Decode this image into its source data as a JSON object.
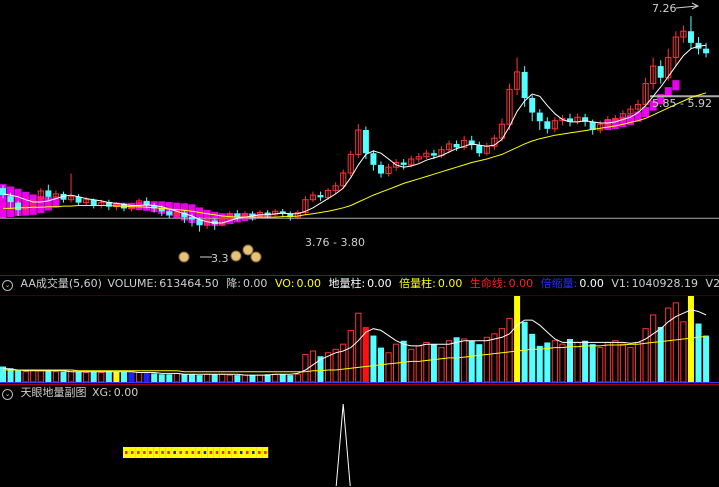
{
  "colors": {
    "bg": "#000000",
    "up": "#ff3232",
    "down": "#54ffff",
    "ma": "#ffffff",
    "ma2": "#ffff00",
    "pink": "#ff00ff",
    "divider": "#a00000",
    "ref_line": "#aaaaaa",
    "vol_line1": "#ffffff",
    "vol_line2": "#ffff00"
  },
  "main_panel": {
    "high_label": "7.26",
    "range_label_top": "5.85 - 5.92",
    "range_label_bottom": "3.76 - 3.80",
    "low_label": "3.3"
  },
  "volume_panel": {
    "toggle_icon": "circle-chevron-icon",
    "title": "AA成交量(5,60)",
    "volume_label": "VOLUME:",
    "volume_value": "613464.50",
    "jiang_label": "降:",
    "jiang_value": "0.00",
    "vo_label": "VO:",
    "vo_value": "0.00",
    "dilz_label": "地量柱:",
    "dilz_value": "0.00",
    "beilz_label": "倍量柱:",
    "beilz_value": "0.00",
    "smx_label": "生命线:",
    "smx_value": "0.00",
    "bsl_label": "倍缩量:",
    "bsl_value": "0.00",
    "v1_label": "V1:",
    "v1_value": "1040928.19",
    "v2_label": "V2:"
  },
  "sub_panel": {
    "toggle_icon": "circle-chevron-icon",
    "title": "天眼地量副图",
    "xg_label": "XG:",
    "xg_value": "0.00"
  },
  "chart_data": [
    {
      "type": "candlestick",
      "title": "",
      "annotations": [
        "7.26",
        "5.85 - 5.92",
        "3.76 - 3.80",
        "3.3"
      ],
      "ylim": [
        3.2,
        7.4
      ],
      "candles": [
        [
          4.3,
          4.18,
          4.35,
          4.12
        ],
        [
          4.16,
          4.06,
          4.22,
          3.95
        ],
        [
          4.05,
          3.92,
          4.08,
          3.82
        ],
        [
          3.93,
          3.98,
          4.02,
          3.85
        ],
        [
          3.98,
          4.1,
          4.12,
          3.92
        ],
        [
          4.12,
          4.25,
          4.3,
          4.08
        ],
        [
          4.26,
          4.15,
          4.36,
          4.1
        ],
        [
          4.15,
          4.2,
          4.26,
          4.1
        ],
        [
          4.2,
          4.1,
          4.24,
          4.05
        ],
        [
          4.1,
          4.15,
          4.55,
          4.05
        ],
        [
          4.15,
          4.05,
          4.2,
          4.0
        ],
        [
          4.05,
          4.1,
          4.15,
          4.0
        ],
        [
          4.1,
          4.0,
          4.12,
          3.95
        ],
        [
          4.0,
          4.05,
          4.1,
          3.95
        ],
        [
          4.06,
          3.98,
          4.1,
          3.92
        ],
        [
          3.98,
          4.02,
          4.06,
          3.92
        ],
        [
          4.02,
          3.95,
          4.05,
          3.9
        ],
        [
          3.95,
          4.0,
          4.05,
          3.9
        ],
        [
          4.0,
          4.08,
          4.12,
          3.95
        ],
        [
          4.08,
          4.0,
          4.14,
          3.95
        ],
        [
          4.0,
          3.95,
          4.04,
          3.88
        ],
        [
          3.95,
          3.9,
          4.0,
          3.82
        ],
        [
          3.9,
          3.84,
          3.94,
          3.78
        ],
        [
          3.84,
          3.88,
          3.92,
          3.76
        ],
        [
          3.88,
          3.8,
          3.92,
          3.7
        ],
        [
          3.8,
          3.76,
          3.86,
          3.64
        ],
        [
          3.76,
          3.66,
          3.8,
          3.55
        ],
        [
          3.66,
          3.74,
          3.8,
          3.6
        ],
        [
          3.74,
          3.68,
          3.78,
          3.58
        ],
        [
          3.68,
          3.78,
          3.84,
          3.64
        ],
        [
          3.78,
          3.86,
          3.9,
          3.72
        ],
        [
          3.86,
          3.8,
          3.92,
          3.74
        ],
        [
          3.8,
          3.86,
          3.9,
          3.76
        ],
        [
          3.86,
          3.82,
          3.9,
          3.74
        ],
        [
          3.82,
          3.88,
          3.92,
          3.78
        ],
        [
          3.88,
          3.84,
          3.92,
          3.78
        ],
        [
          3.84,
          3.9,
          3.94,
          3.8
        ],
        [
          3.9,
          3.86,
          3.94,
          3.8
        ],
        [
          3.86,
          3.8,
          3.9,
          3.74
        ],
        [
          3.8,
          3.88,
          3.92,
          3.76
        ],
        [
          3.88,
          4.1,
          4.16,
          3.84
        ],
        [
          4.1,
          4.18,
          4.24,
          4.06
        ],
        [
          4.18,
          4.14,
          4.24,
          4.08
        ],
        [
          4.14,
          4.26,
          4.3,
          4.1
        ],
        [
          4.26,
          4.34,
          4.4,
          4.2
        ],
        [
          4.34,
          4.56,
          4.62,
          4.3
        ],
        [
          4.56,
          4.88,
          4.94,
          4.5
        ],
        [
          4.88,
          5.3,
          5.4,
          4.82
        ],
        [
          5.3,
          4.9,
          5.36,
          4.8
        ],
        [
          4.9,
          4.7,
          4.95,
          4.6
        ],
        [
          4.7,
          4.55,
          4.76,
          4.48
        ],
        [
          4.55,
          4.66,
          4.72,
          4.5
        ],
        [
          4.66,
          4.74,
          4.8,
          4.6
        ],
        [
          4.74,
          4.7,
          4.8,
          4.62
        ],
        [
          4.7,
          4.8,
          4.86,
          4.66
        ],
        [
          4.8,
          4.84,
          4.9,
          4.74
        ],
        [
          4.84,
          4.9,
          4.96,
          4.8
        ],
        [
          4.9,
          4.86,
          4.96,
          4.8
        ],
        [
          4.86,
          4.96,
          5.02,
          4.82
        ],
        [
          4.96,
          5.06,
          5.12,
          4.9
        ],
        [
          5.06,
          5.0,
          5.12,
          4.94
        ],
        [
          5.0,
          5.12,
          5.2,
          4.96
        ],
        [
          5.12,
          5.04,
          5.2,
          4.96
        ],
        [
          5.04,
          4.9,
          5.1,
          4.84
        ],
        [
          4.9,
          5.02,
          5.08,
          4.86
        ],
        [
          5.02,
          5.16,
          5.22,
          4.96
        ],
        [
          5.16,
          5.4,
          5.5,
          5.1
        ],
        [
          5.4,
          6.0,
          6.1,
          5.3
        ],
        [
          6.0,
          6.3,
          6.55,
          5.9
        ],
        [
          6.3,
          5.85,
          6.4,
          5.7
        ],
        [
          5.85,
          5.6,
          5.9,
          5.45
        ],
        [
          5.6,
          5.45,
          5.66,
          5.3
        ],
        [
          5.45,
          5.32,
          5.52,
          5.24
        ],
        [
          5.32,
          5.46,
          5.52,
          5.26
        ],
        [
          5.46,
          5.5,
          5.56,
          5.38
        ],
        [
          5.5,
          5.44,
          5.58,
          5.36
        ],
        [
          5.44,
          5.52,
          5.58,
          5.4
        ],
        [
          5.52,
          5.44,
          5.58,
          5.36
        ],
        [
          5.44,
          5.3,
          5.48,
          5.22
        ],
        [
          5.3,
          5.4,
          5.46,
          5.24
        ],
        [
          5.4,
          5.48,
          5.54,
          5.34
        ],
        [
          5.48,
          5.5,
          5.56,
          5.42
        ],
        [
          5.5,
          5.58,
          5.64,
          5.44
        ],
        [
          5.58,
          5.66,
          5.72,
          5.52
        ],
        [
          5.66,
          5.74,
          5.82,
          5.6
        ],
        [
          5.74,
          6.1,
          6.2,
          5.7
        ],
        [
          6.1,
          6.4,
          6.55,
          6.0
        ],
        [
          6.4,
          6.2,
          6.5,
          6.1
        ],
        [
          6.2,
          6.55,
          6.7,
          6.15
        ],
        [
          6.55,
          6.9,
          7.0,
          6.4
        ],
        [
          6.9,
          7.0,
          7.1,
          6.8
        ],
        [
          7.0,
          6.8,
          7.26,
          6.7
        ],
        [
          6.8,
          6.7,
          6.9,
          6.6
        ],
        [
          6.7,
          6.62,
          6.8,
          6.55
        ]
      ],
      "ma_short": [
        4.2,
        4.18,
        4.15,
        4.1,
        4.06,
        4.06,
        4.08,
        4.12,
        4.16,
        4.18,
        4.15,
        4.12,
        4.1,
        4.08,
        4.05,
        4.04,
        4.02,
        4.0,
        4.0,
        4.01,
        4.0,
        3.98,
        3.94,
        3.9,
        3.86,
        3.82,
        3.76,
        3.72,
        3.7,
        3.7,
        3.74,
        3.78,
        3.8,
        3.82,
        3.84,
        3.84,
        3.86,
        3.87,
        3.86,
        3.86,
        3.9,
        3.96,
        4.04,
        4.12,
        4.2,
        4.3,
        4.48,
        4.7,
        4.88,
        4.94,
        4.9,
        4.8,
        4.7,
        4.66,
        4.68,
        4.72,
        4.78,
        4.82,
        4.86,
        4.92,
        4.98,
        5.02,
        5.06,
        5.04,
        5.02,
        5.04,
        5.14,
        5.36,
        5.62,
        5.8,
        5.92,
        5.88,
        5.72,
        5.58,
        5.48,
        5.44,
        5.44,
        5.46,
        5.44,
        5.42,
        5.42,
        5.44,
        5.48,
        5.52,
        5.6,
        5.72,
        5.88,
        6.04,
        6.22,
        6.4,
        6.58,
        6.7,
        6.74,
        6.76
      ],
      "ma_long": [
        3.95,
        3.95,
        3.96,
        3.96,
        3.97,
        3.97,
        3.98,
        3.98,
        3.99,
        3.99,
        4.0,
        4.0,
        4.0,
        4.0,
        4.0,
        3.99,
        3.99,
        3.98,
        3.98,
        3.97,
        3.96,
        3.95,
        3.94,
        3.93,
        3.92,
        3.9,
        3.88,
        3.86,
        3.84,
        3.82,
        3.81,
        3.8,
        3.8,
        3.8,
        3.8,
        3.8,
        3.8,
        3.81,
        3.81,
        3.82,
        3.84,
        3.86,
        3.88,
        3.9,
        3.93,
        3.96,
        4.0,
        4.06,
        4.12,
        4.18,
        4.23,
        4.28,
        4.33,
        4.38,
        4.42,
        4.46,
        4.5,
        4.54,
        4.58,
        4.62,
        4.66,
        4.7,
        4.74,
        4.77,
        4.8,
        4.84,
        4.88,
        4.94,
        5.0,
        5.06,
        5.11,
        5.15,
        5.18,
        5.21,
        5.23,
        5.25,
        5.27,
        5.29,
        5.31,
        5.33,
        5.35,
        5.37,
        5.4,
        5.43,
        5.46,
        5.5,
        5.56,
        5.62,
        5.68,
        5.74,
        5.8,
        5.86,
        5.9,
        5.94
      ],
      "reference_lines": [
        3.78,
        5.88
      ]
    },
    {
      "type": "bar",
      "title": "AA成交量(5,60)",
      "ylim": [
        0,
        100
      ],
      "volumes": [
        18,
        16,
        14,
        12,
        14,
        13,
        13,
        12,
        12,
        14,
        12,
        11,
        12,
        11,
        13,
        12,
        12,
        11,
        11,
        12,
        10,
        9,
        9,
        10,
        9,
        9,
        8,
        9,
        9,
        9,
        8,
        8,
        8,
        8,
        8,
        9,
        9,
        9,
        8,
        9,
        32,
        36,
        30,
        34,
        38,
        44,
        60,
        80,
        64,
        54,
        40,
        34,
        44,
        48,
        38,
        42,
        46,
        44,
        40,
        48,
        52,
        50,
        48,
        44,
        52,
        56,
        62,
        74,
        100,
        70,
        56,
        42,
        46,
        48,
        44,
        50,
        46,
        48,
        44,
        40,
        46,
        48,
        44,
        40,
        46,
        62,
        78,
        64,
        86,
        92,
        70,
        100,
        68,
        54
      ],
      "highlights": {
        "yellow": [
          15,
          68,
          91
        ],
        "red": [
          48
        ],
        "blue": [
          17,
          19
        ]
      },
      "line1": [
        16,
        15,
        14,
        13,
        13,
        13,
        13,
        13,
        13,
        12,
        12,
        12,
        12,
        12,
        12,
        12,
        12,
        12,
        11,
        11,
        11,
        10,
        10,
        10,
        9,
        9,
        9,
        9,
        9,
        9,
        9,
        9,
        8,
        8,
        8,
        8,
        9,
        9,
        9,
        10,
        14,
        20,
        26,
        30,
        34,
        36,
        40,
        48,
        58,
        62,
        60,
        54,
        48,
        44,
        42,
        42,
        44,
        44,
        44,
        44,
        46,
        48,
        48,
        48,
        48,
        50,
        52,
        56,
        66,
        72,
        72,
        66,
        58,
        50,
        46,
        46,
        46,
        46,
        46,
        46,
        46,
        46,
        46,
        45,
        46,
        50,
        56,
        62,
        70,
        76,
        80,
        84,
        82,
        78
      ],
      "line2": [
        14,
        14,
        14,
        14,
        14,
        14,
        14,
        14,
        14,
        14,
        13,
        13,
        13,
        13,
        13,
        13,
        13,
        13,
        13,
        13,
        13,
        13,
        13,
        13,
        12,
        12,
        12,
        12,
        12,
        12,
        12,
        12,
        12,
        12,
        12,
        12,
        12,
        12,
        12,
        12,
        12,
        13,
        13,
        14,
        14,
        15,
        16,
        17,
        18,
        19,
        20,
        21,
        22,
        23,
        24,
        24,
        25,
        26,
        27,
        28,
        28,
        29,
        30,
        31,
        32,
        33,
        34,
        35,
        36,
        37,
        38,
        38,
        39,
        40,
        40,
        41,
        41,
        42,
        42,
        42,
        43,
        43,
        43,
        44,
        44,
        45,
        46,
        47,
        48,
        49,
        50,
        51,
        52,
        53
      ]
    },
    {
      "type": "area",
      "title": "天眼地量副图",
      "ylim": [
        0,
        1
      ],
      "xg_signal_index": 45,
      "marker_cells": [
        "y",
        "y",
        "y",
        "y",
        "y",
        "y",
        "y",
        "y",
        "b",
        "y",
        "y",
        "y",
        "y",
        "b",
        "y",
        "y",
        "y",
        "y",
        "y",
        "b",
        "y",
        "b",
        "y",
        "y"
      ]
    }
  ]
}
